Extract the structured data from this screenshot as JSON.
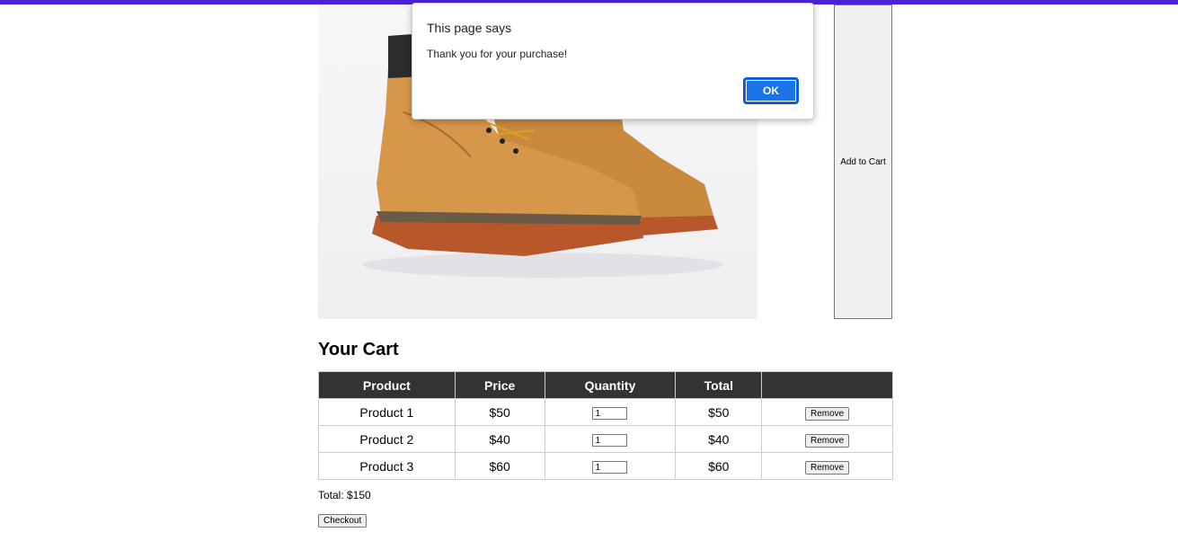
{
  "colors": {
    "top_bar": "#4f1fd6",
    "table_header_bg": "#333333",
    "dialog_ok": "#1a73e8"
  },
  "product": {
    "image_alt": "boots-product-image",
    "add_to_cart_label": "Add to Cart"
  },
  "cart": {
    "title": "Your Cart",
    "columns": [
      "Product",
      "Price",
      "Quantity",
      "Total",
      ""
    ],
    "rows": [
      {
        "product": "Product 1",
        "price": "$50",
        "quantity": "1",
        "total": "$50",
        "remove_label": "Remove"
      },
      {
        "product": "Product 2",
        "price": "$40",
        "quantity": "1",
        "total": "$40",
        "remove_label": "Remove"
      },
      {
        "product": "Product 3",
        "price": "$60",
        "quantity": "1",
        "total": "$60",
        "remove_label": "Remove"
      }
    ],
    "total_text": "Total: $150",
    "checkout_label": "Checkout"
  },
  "dialog": {
    "title": "This page says",
    "message": "Thank you for your purchase!",
    "ok_label": "OK"
  }
}
